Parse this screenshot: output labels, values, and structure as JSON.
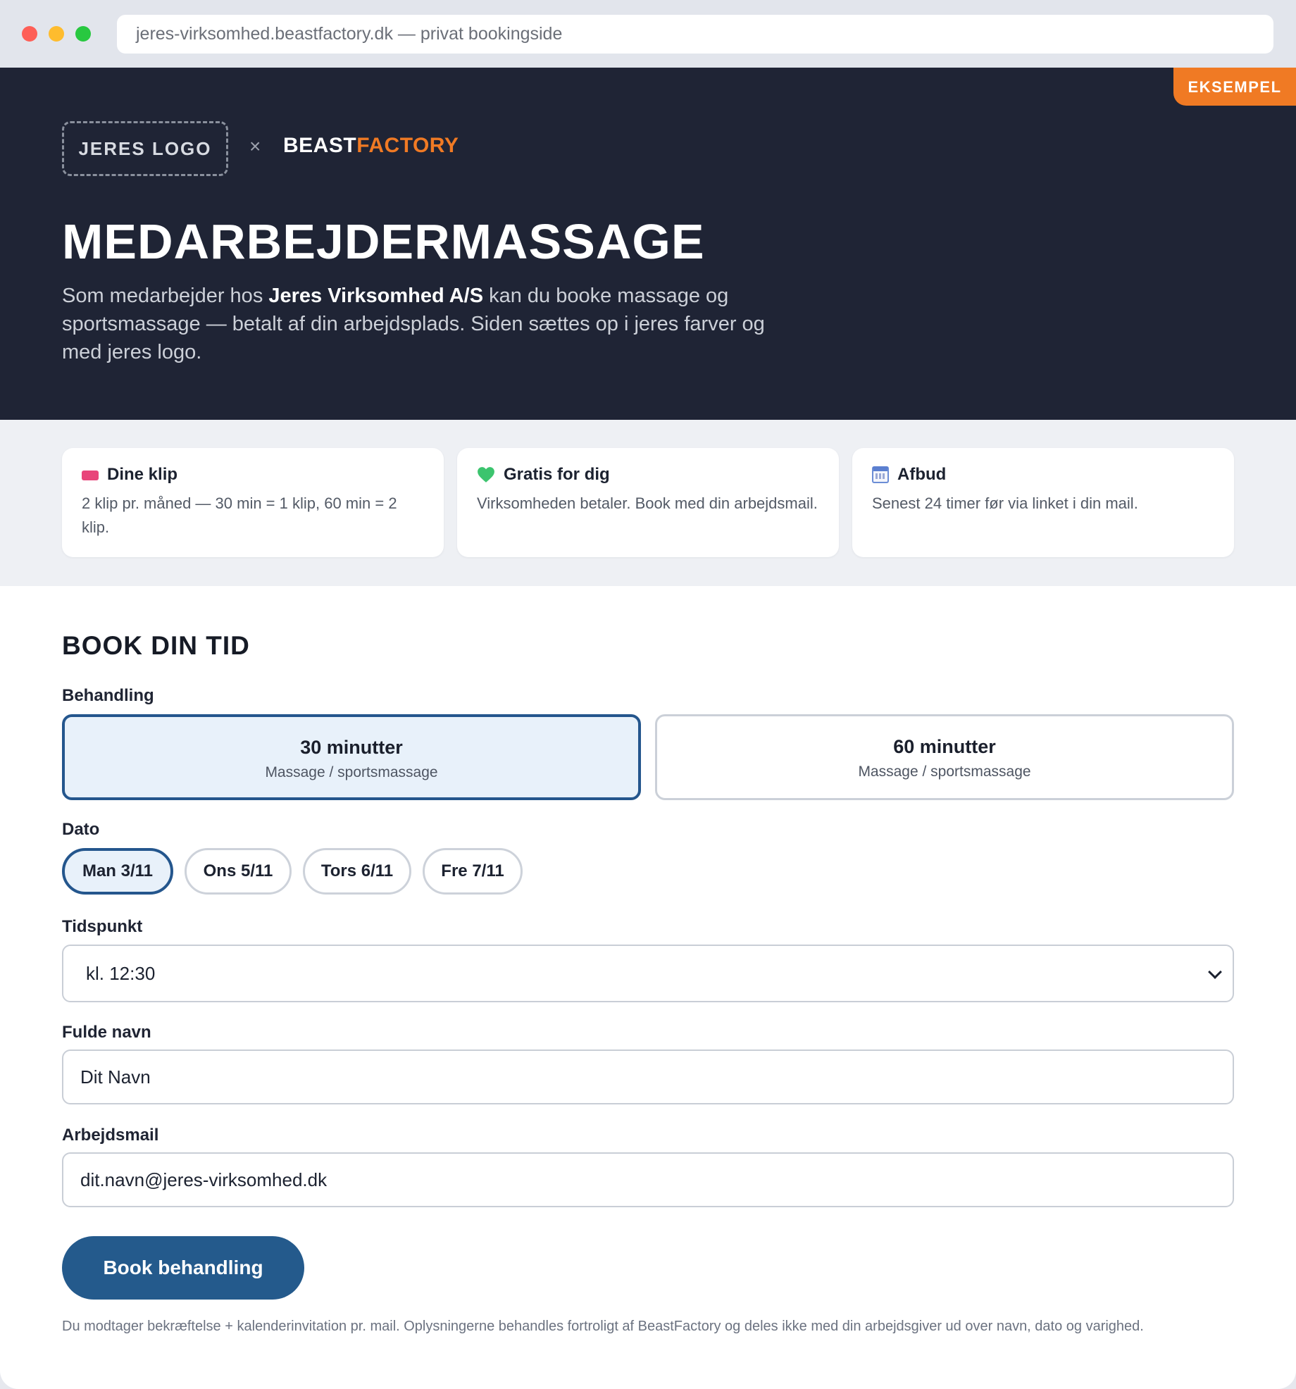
{
  "browser": {
    "url": "jeres-virksomhed.beastfactory.dk — privat bookingside"
  },
  "hero": {
    "badge": "EKSEMPEL",
    "logo_placeholder": "JERES LOGO",
    "separator": "×",
    "brand_part1": "BEAST",
    "brand_part2": "FACTORY",
    "title": "MEDARBEJDERMASSAGE",
    "desc_before": "Som medarbejder hos ",
    "desc_company": "Jeres Virksomhed A/S",
    "desc_after": " kan du booke massage og sportsmassage — betalt af din arbejdsplads. Siden sættes op i jeres farver og med jeres logo."
  },
  "info_cards": [
    {
      "icon": "ticket-icon",
      "title": "Dine klip",
      "text": "2 klip pr. måned — 30 min = 1 klip, 60 min = 2 klip."
    },
    {
      "icon": "green-heart-icon",
      "title": "Gratis for dig",
      "text": "Virksomheden betaler. Book med din arbejdsmail."
    },
    {
      "icon": "calendar-icon",
      "title": "Afbud",
      "text": "Senest 24 timer før via linket i din mail."
    }
  ],
  "booking": {
    "section_title": "BOOK DIN TID",
    "treatment_label": "Behandling",
    "treatments": [
      {
        "title": "30 minutter",
        "subtitle": "Massage / sportsmassage",
        "selected": true
      },
      {
        "title": "60 minutter",
        "subtitle": "Massage / sportsmassage",
        "selected": false
      }
    ],
    "date_label": "Dato",
    "dates": [
      {
        "label": "Man 3/11",
        "selected": true
      },
      {
        "label": "Ons 5/11",
        "selected": false
      },
      {
        "label": "Tors 6/11",
        "selected": false
      },
      {
        "label": "Fre 7/11",
        "selected": false
      }
    ],
    "time_label": "Tidspunkt",
    "time_value": "kl. 12:30",
    "name_label": "Fulde navn",
    "name_value": "Dit Navn",
    "email_label": "Arbejdsmail",
    "email_value": "dit.navn@jeres-virksomhed.dk",
    "submit_label": "Book behandling",
    "footnote": "Du modtager bekræftelse + kalenderinvitation pr. mail. Oplysningerne behandles fortroligt af BeastFactory og deles ikke med din arbejdsgiver ud over navn, dato og varighed."
  },
  "colors": {
    "hero_bg": "#1f2435",
    "accent_orange": "#f07a24",
    "primary_blue": "#245a8c",
    "selected_bg": "#e8f1fa"
  }
}
